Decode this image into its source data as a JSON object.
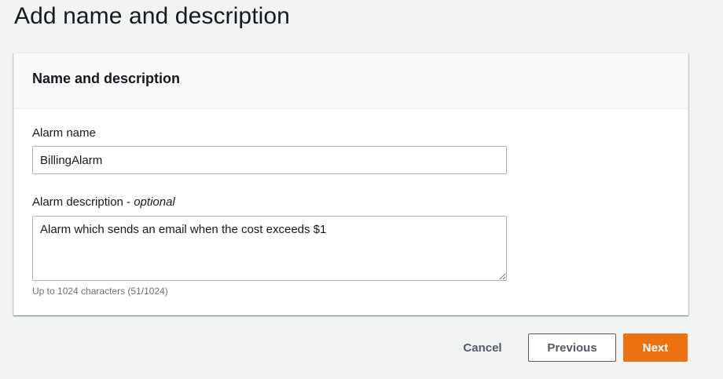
{
  "page": {
    "title": "Add name and description"
  },
  "panel": {
    "title": "Name and description"
  },
  "form": {
    "name_label": "Alarm name",
    "name_value": "BillingAlarm",
    "description_label": "Alarm description - ",
    "description_optional": "optional",
    "description_value": "Alarm which sends an email when the cost exceeds $1",
    "description_hint": "Up to 1024 characters (51/1024)"
  },
  "actions": {
    "cancel_label": "Cancel",
    "previous_label": "Previous",
    "next_label": "Next"
  },
  "colors": {
    "page_background": "#f2f3f3",
    "primary_button": "#ec7211",
    "secondary_text": "#545b64"
  }
}
